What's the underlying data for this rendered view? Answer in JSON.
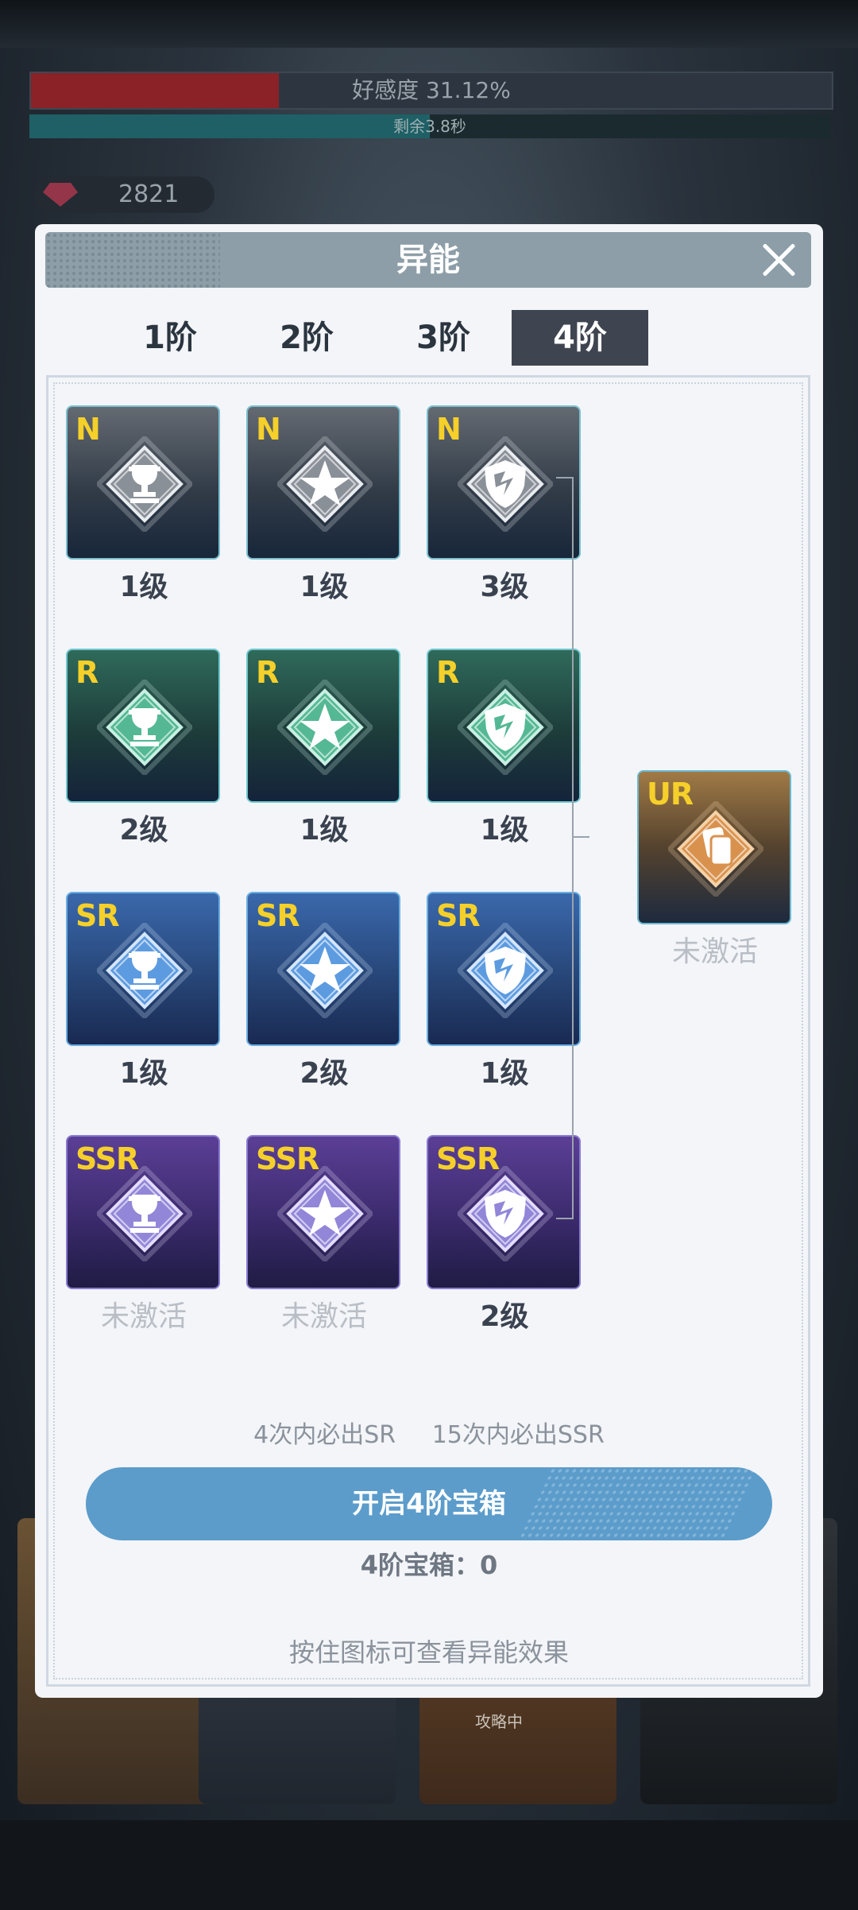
{
  "background": {
    "favor_label": "好感度 31.12%",
    "favor_progress": 0.31,
    "remaining_label": "剩余3.8秒",
    "remaining_progress": 0.5,
    "gem_count": "2821",
    "card_tag": "攻略中"
  },
  "modal": {
    "title": "异能",
    "tabs": [
      "1阶",
      "2阶",
      "3阶",
      "4阶"
    ],
    "active_tab": "4阶",
    "grid": [
      [
        {
          "rarity": "N",
          "icon": "trophy-icon",
          "level": "1级"
        },
        {
          "rarity": "N",
          "icon": "star-icon",
          "level": "1级"
        },
        {
          "rarity": "N",
          "icon": "shield-icon",
          "level": "3级"
        }
      ],
      [
        {
          "rarity": "R",
          "icon": "trophy-icon",
          "level": "2级"
        },
        {
          "rarity": "R",
          "icon": "star-icon",
          "level": "1级"
        },
        {
          "rarity": "R",
          "icon": "shield-icon",
          "level": "1级"
        }
      ],
      [
        {
          "rarity": "SR",
          "icon": "trophy-icon",
          "level": "1级"
        },
        {
          "rarity": "SR",
          "icon": "star-icon",
          "level": "2级"
        },
        {
          "rarity": "SR",
          "icon": "shield-icon",
          "level": "1级"
        }
      ],
      [
        {
          "rarity": "SSR",
          "icon": "trophy-icon",
          "level": "未激活"
        },
        {
          "rarity": "SSR",
          "icon": "star-icon",
          "level": "未激活"
        },
        {
          "rarity": "SSR",
          "icon": "shield-icon",
          "level": "2级"
        }
      ]
    ],
    "ultimate": {
      "rarity": "UR",
      "icon": "cards-icon",
      "level": "未激活"
    },
    "pity_sr": "4次内必出SR",
    "pity_ssr": "15次内必出SSR",
    "open_button": "开启4阶宝箱",
    "chest_count": "4阶宝箱：0",
    "hint": "按住图标可查看异能效果"
  },
  "colors": {
    "rarity_label": "#f6d02a",
    "active_tab_bg": "#3f4550",
    "button_bg": "#5b9ccb",
    "header_bg": "#8d9ea8"
  }
}
